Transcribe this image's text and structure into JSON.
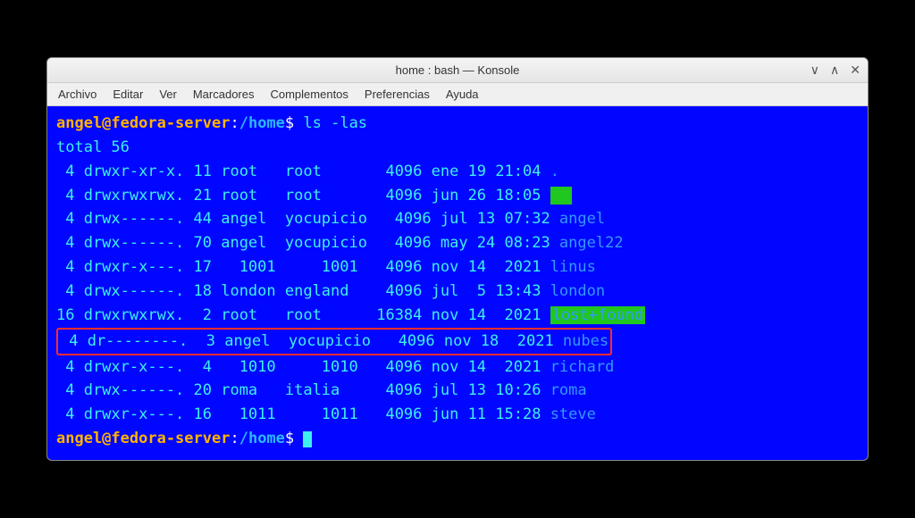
{
  "window": {
    "title": "home : bash — Konsole"
  },
  "menu": {
    "items": [
      "Archivo",
      "Editar",
      "Ver",
      "Marcadores",
      "Complementos",
      "Preferencias",
      "Ayuda"
    ]
  },
  "prompt": {
    "user_host": "angel@fedora-server",
    "sep": ":",
    "path": "/home",
    "sigil": "$"
  },
  "cmd": "ls -las",
  "total_line": "total 56",
  "rows": [
    {
      "blocks": " 4",
      "perms": "drwxr-xr-x.",
      "links": "11",
      "owner": "root  ",
      "group": "root    ",
      "size": "  4096",
      "date": "ene 19 21:04",
      "name": ".",
      "kind": "dir",
      "hl": null
    },
    {
      "blocks": " 4",
      "perms": "drwxrwxrwx.",
      "links": "21",
      "owner": "root  ",
      "group": "root    ",
      "size": "  4096",
      "date": "jun 26 18:05",
      "name": "  ",
      "kind": "dir",
      "hl": "green"
    },
    {
      "blocks": " 4",
      "perms": "drwx------.",
      "links": "44",
      "owner": "angel ",
      "group": "yocupicio",
      "size": "  4096",
      "date": "jul 13 07:32",
      "name": "angel",
      "kind": "dir",
      "hl": null
    },
    {
      "blocks": " 4",
      "perms": "drwx------.",
      "links": "70",
      "owner": "angel ",
      "group": "yocupicio",
      "size": "  4096",
      "date": "may 24 08:23",
      "name": "angel22",
      "kind": "dir",
      "hl": null
    },
    {
      "blocks": " 4",
      "perms": "drwxr-x---.",
      "links": "17",
      "owner": "  1001",
      "group": "    1001",
      "size": "  4096",
      "date": "nov 14  2021",
      "name": "linus",
      "kind": "dir",
      "hl": null
    },
    {
      "blocks": " 4",
      "perms": "drwx------.",
      "links": "18",
      "owner": "london",
      "group": "england ",
      "size": "  4096",
      "date": "jul  5 13:43",
      "name": "london",
      "kind": "dir",
      "hl": null
    },
    {
      "blocks": "16",
      "perms": "drwxrwxrwx.",
      "links": " 2",
      "owner": "root  ",
      "group": "root    ",
      "size": " 16384",
      "date": "nov 14  2021",
      "name": "lost+found",
      "kind": "dir",
      "hl": "lf"
    },
    {
      "blocks": " 4",
      "perms": "dr--------.",
      "links": " 3",
      "owner": "angel ",
      "group": "yocupicio",
      "size": "  4096",
      "date": "nov 18  2021",
      "name": "nubes",
      "kind": "dir",
      "hl": null,
      "boxed": true
    },
    {
      "blocks": " 4",
      "perms": "drwxr-x---.",
      "links": " 4",
      "owner": "  1010",
      "group": "    1010",
      "size": "  4096",
      "date": "nov 14  2021",
      "name": "richard",
      "kind": "dir",
      "hl": null
    },
    {
      "blocks": " 4",
      "perms": "drwx------.",
      "links": "20",
      "owner": "roma  ",
      "group": "italia  ",
      "size": "  4096",
      "date": "jul 13 10:26",
      "name": "roma",
      "kind": "dir",
      "hl": null
    },
    {
      "blocks": " 4",
      "perms": "drwxr-x---.",
      "links": "16",
      "owner": "  1011",
      "group": "    1011",
      "size": "  4096",
      "date": "jun 11 15:28",
      "name": "steve",
      "kind": "dir",
      "hl": null
    }
  ]
}
